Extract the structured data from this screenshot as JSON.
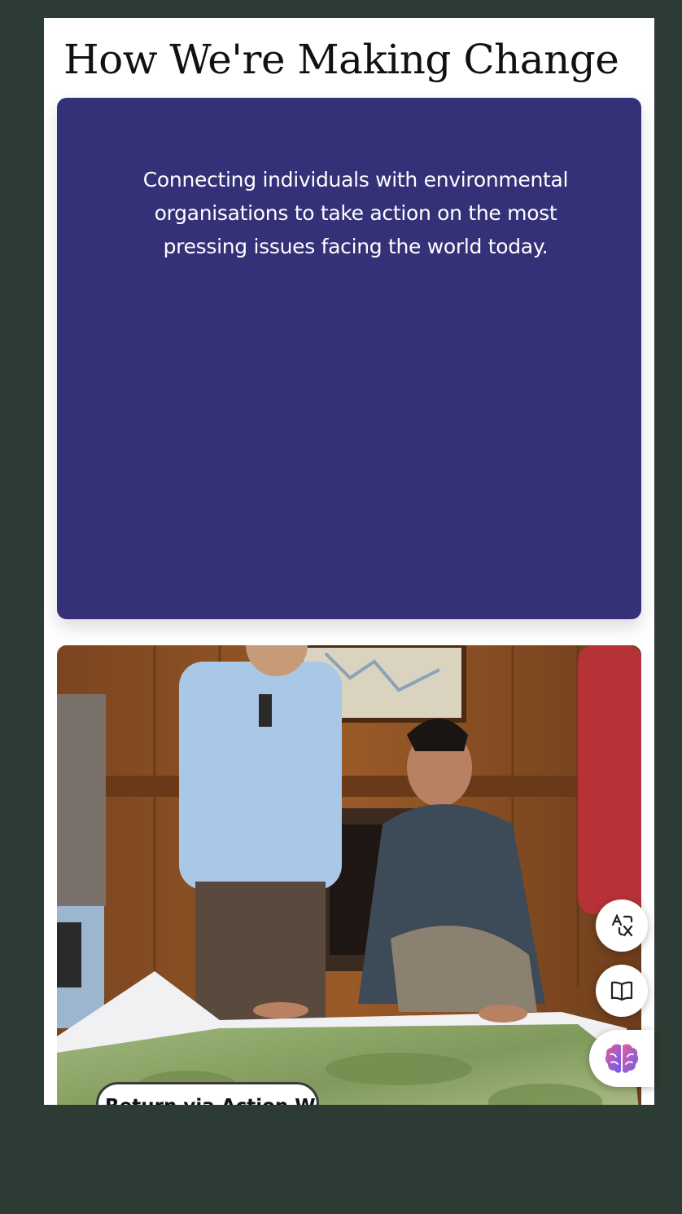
{
  "page": {
    "title": "How We're Making Change"
  },
  "mission_card": {
    "text": "Connecting individuals with environmental organisations to take action on the most pressing issues facing the world today.",
    "background": "#343178"
  },
  "photo_card": {
    "button_label": "Return via Action Work"
  },
  "floating_tools": {
    "translate_icon": "translate-icon",
    "reader_icon": "book-icon",
    "ai_icon": "brain-icon"
  },
  "colors": {
    "backdrop": "#2c3b33",
    "accent": "#343178"
  }
}
